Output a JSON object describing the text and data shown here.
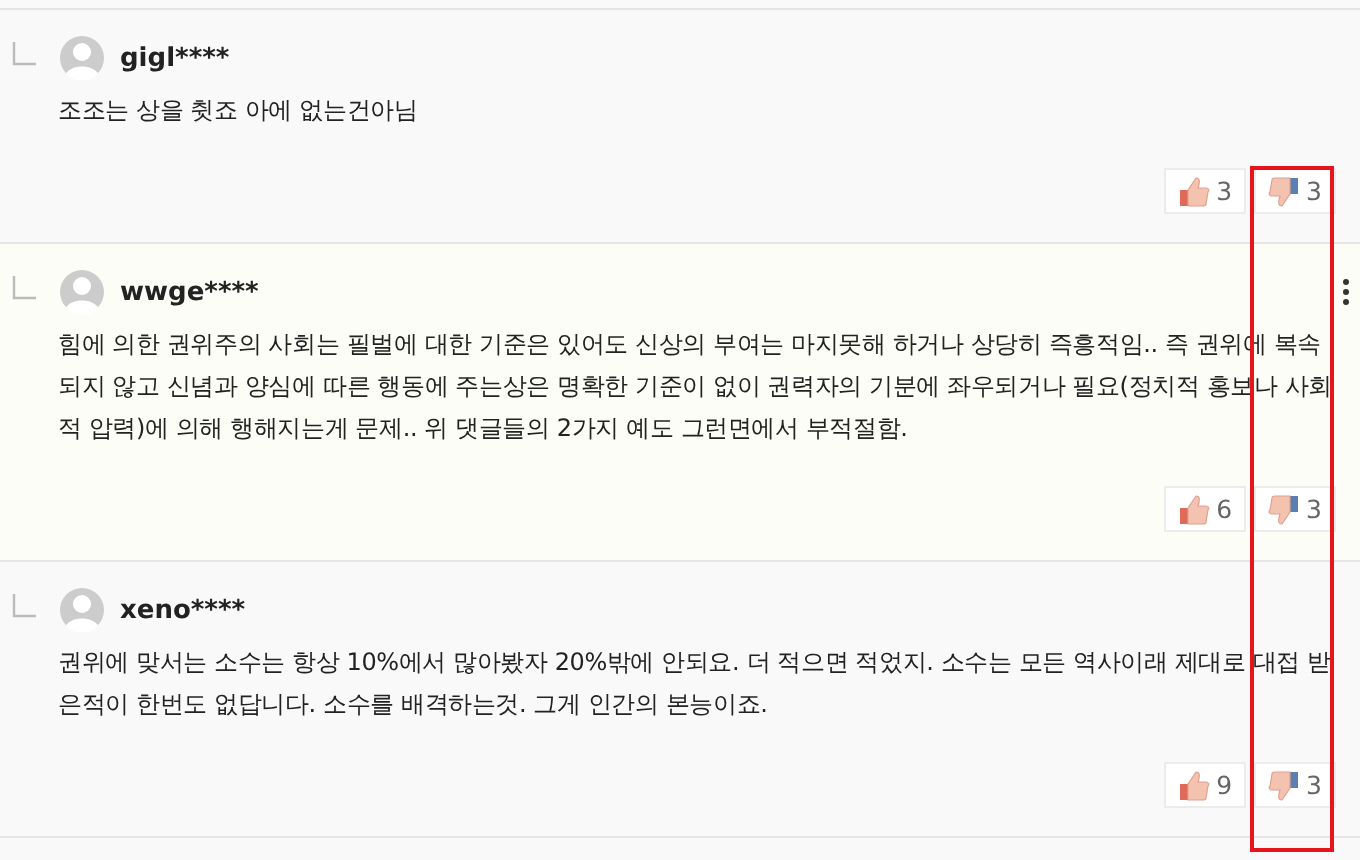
{
  "comments": [
    {
      "username": "gigl****",
      "text": "조조는 상을 췻죠 아에 없는건아님",
      "likes": "3",
      "dislikes": "3",
      "hovered": false
    },
    {
      "username": "wwge****",
      "text": "힘에 의한 권위주의 사회는 필벌에 대한 기준은 있어도 신상의 부여는 마지못해 하거나 상당히 즉흥적임.. 즉 권위에 복속되지 않고 신념과 양심에 따른 행동에 주는상은 명확한 기준이 없이 권력자의 기분에 좌우되거나 필요(정치적 홍보나 사회적 압력)에 의해 행해지는게 문제.. 위 댓글들의 2가지 예도 그런면에서 부적절함.",
      "likes": "6",
      "dislikes": "3",
      "hovered": true
    },
    {
      "username": "xeno****",
      "text": "권위에 맞서는 소수는 항상 10%에서 많아봤자 20%밖에 안되요. 더 적으면 적었지. 소수는 모든 역사이래 제대로 대접 받은적이 한번도 없답니다. 소수를 배격하는것. 그게 인간의 본능이죠.",
      "likes": "9",
      "dislikes": "3",
      "hovered": false
    }
  ]
}
